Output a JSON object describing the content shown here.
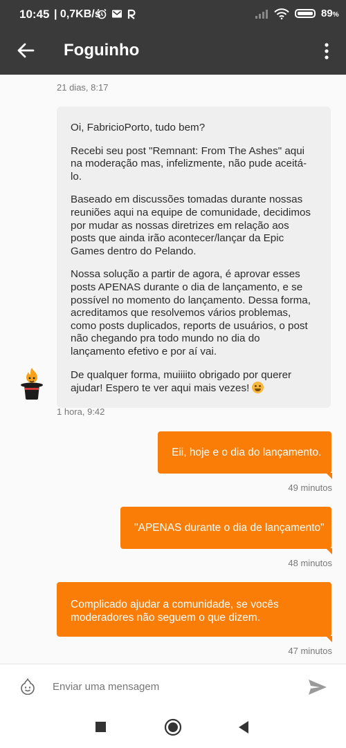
{
  "status_bar": {
    "time": "10:45",
    "network": "| 0,7KB/s",
    "battery": "89",
    "battery_unit": "%",
    "icons": [
      "alarm-icon",
      "gmail-icon",
      "app-r-icon",
      "signal-icon",
      "wifi-icon",
      "battery-icon"
    ]
  },
  "app_bar": {
    "title": "Foguinho",
    "back_icon": "arrow-left-icon",
    "menu_icon": "more-vertical-icon"
  },
  "messages": [
    {
      "direction": "incoming",
      "timestamp_above": "21 dias, 8:17",
      "paragraphs": [
        "Oi, FabricioPorto, tudo bem?",
        "Recebi seu post \"Remnant: From The Ashes\" aqui na moderação mas, infelizmente, não pude aceitá-lo.",
        "Baseado em discussões tomadas durante nossas reuniões aqui na equipe de comunidade, decidimos por mudar as nossas diretrizes em relação aos posts que ainda irão acontecer/lançar da Epic Games dentro do Pelando.",
        "Nossa solução a partir de agora, é aprovar esses posts APENAS durante o dia de lançamento, e se possível no momento do lançamento. Dessa forma, acreditamos que resolvemos vários problemas, como posts duplicados, reports de usuários, o post não chegando pra todo mundo no dia do lançamento efetivo e por aí vai.",
        "De qualquer forma, muiiiito obrigado por querer ajudar! Espero te ver aqui mais vezes!"
      ],
      "timestamp_below": "1 hora, 9:42"
    },
    {
      "direction": "outgoing",
      "text": "Eii, hoje e o dia do lançamento.",
      "timestamp": "49 minutos"
    },
    {
      "direction": "outgoing",
      "text": "\"APENAS durante o dia de lançamento\"",
      "timestamp": "48 minutos"
    },
    {
      "direction": "outgoing",
      "text": "Complicado ajudar a comunidade, se vocês moderadores não seguem o que dizem.",
      "timestamp": "47 minutos"
    }
  ],
  "input": {
    "placeholder": "Enviar uma mensagem",
    "emoji_icon": "flame-face-icon",
    "send_icon": "send-icon"
  },
  "nav": [
    "recents-square-icon",
    "home-circle-icon",
    "back-triangle-icon"
  ],
  "colors": {
    "accent": "#f97d07",
    "bar": "#3a3a3a",
    "incoming_bubble": "#efefef"
  }
}
